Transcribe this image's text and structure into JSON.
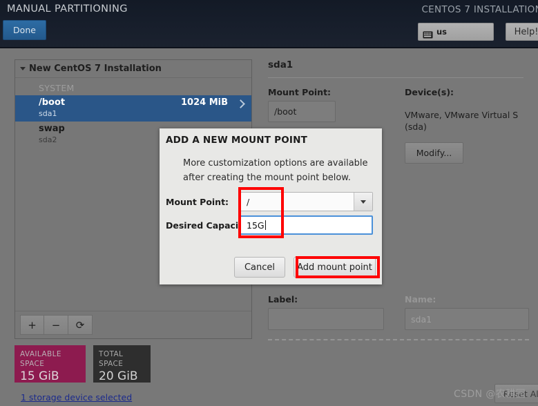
{
  "header": {
    "title": "MANUAL PARTITIONING",
    "installer_title": "CENTOS 7 INSTALLATION",
    "done_label": "Done",
    "keyboard_layout": "us",
    "keyboard_icon": "keyboard-icon",
    "help_label": "Help!"
  },
  "left_panel": {
    "tree_root": "New CentOS 7 Installation",
    "group_label": "SYSTEM",
    "expand_icon": "chevron-down-icon",
    "rows": [
      {
        "name": "/boot",
        "device": "sda1",
        "size": "1024 MiB",
        "selected": true,
        "chevron": "chevron-right-icon"
      },
      {
        "name": "swap",
        "device": "sda2",
        "size": "",
        "selected": false,
        "chevron": ""
      }
    ],
    "toolbar": {
      "add_label": "+",
      "remove_label": "−",
      "refresh_label": "⟳"
    }
  },
  "space_summary": {
    "available_caption": "AVAILABLE SPACE",
    "available_value": "15 GiB",
    "available_color": "#8d1b4f",
    "total_caption": "TOTAL SPACE",
    "total_value": "20 GiB",
    "total_color": "#2e2e2e",
    "device_link": "1 storage device selected"
  },
  "right_panel": {
    "title": "sda1",
    "mount_point_label": "Mount Point:",
    "mount_point_value": "/boot",
    "devices_label": "Device(s):",
    "devices_value": "VMware, VMware Virtual S (sda)",
    "modify_label": "Modify...",
    "label_label": "Label:",
    "label_value": "",
    "name_label": "Name:",
    "name_value": "sda1",
    "reset_label": "Reset All"
  },
  "dialog": {
    "title": "ADD A NEW MOUNT POINT",
    "description": "More customization options are available after creating the mount point below.",
    "mount_point_label": "Mount Point:",
    "mount_point_value": "/",
    "dropdown_icon": "chevron-down-icon",
    "capacity_label": "Desired Capacity:",
    "capacity_value": "15G",
    "cancel_label": "Cancel",
    "add_label": "Add mount point"
  },
  "annotations": {
    "highlight_color": "#fe0000"
  },
  "watermark": "CSDN @农耕园"
}
